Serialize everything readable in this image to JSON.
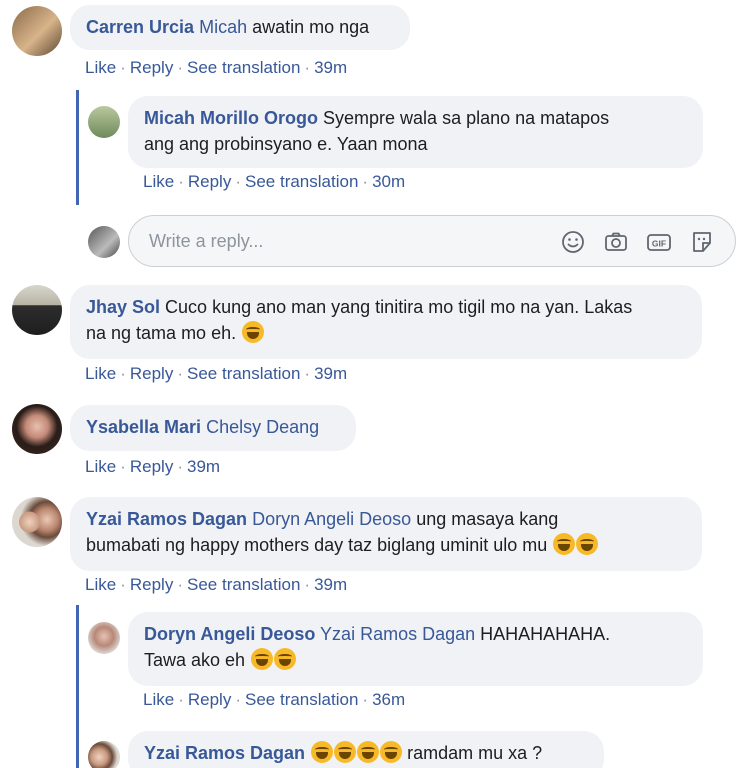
{
  "labels": {
    "like": "Like",
    "reply": "Reply",
    "see_translation": "See translation",
    "dot": "·"
  },
  "comments": [
    {
      "author": "Carren Urcia",
      "mention": "Micah",
      "text": "awatin mo nga",
      "time": "39m"
    },
    {
      "author": "Micah Morillo Orogo",
      "line1": "Syempre wala sa plano na matapos",
      "line2": "ang ang probinsyano e. Yaan mona",
      "time": "30m"
    },
    {
      "author": "Jhay Sol",
      "line1": "Cuco kung ano man yang tinitira mo tigil mo na yan. Lakas",
      "line2": "na ng tama mo eh.",
      "time": "39m"
    },
    {
      "author": "Ysabella Mari",
      "mention": "Chelsy Deang",
      "time": "39m"
    },
    {
      "author": "Yzai Ramos Dagan",
      "mention": "Doryn Angeli Deoso",
      "line1": "ung masaya kang",
      "line2": "bumabati ng happy mothers day taz biglang uminit ulo mu",
      "time": "39m"
    },
    {
      "author": "Doryn Angeli Deoso",
      "mention": "Yzai Ramos Dagan",
      "line1": "HAHAHAHAHA.",
      "line2": "Tawa ako eh",
      "time": "36m"
    },
    {
      "author": "Yzai Ramos Dagan",
      "text": "ramdam mu xa ?"
    }
  ],
  "reply_box": {
    "placeholder": "Write a reply...",
    "gif_label": "GIF",
    "icons": [
      "emoji-icon",
      "camera-icon",
      "gif-icon",
      "sticker-icon"
    ]
  },
  "colors": {
    "link": "#385898",
    "bubble": "#f0f2f5",
    "thread_line": "#4267b2",
    "emoji": "#f7b928"
  }
}
